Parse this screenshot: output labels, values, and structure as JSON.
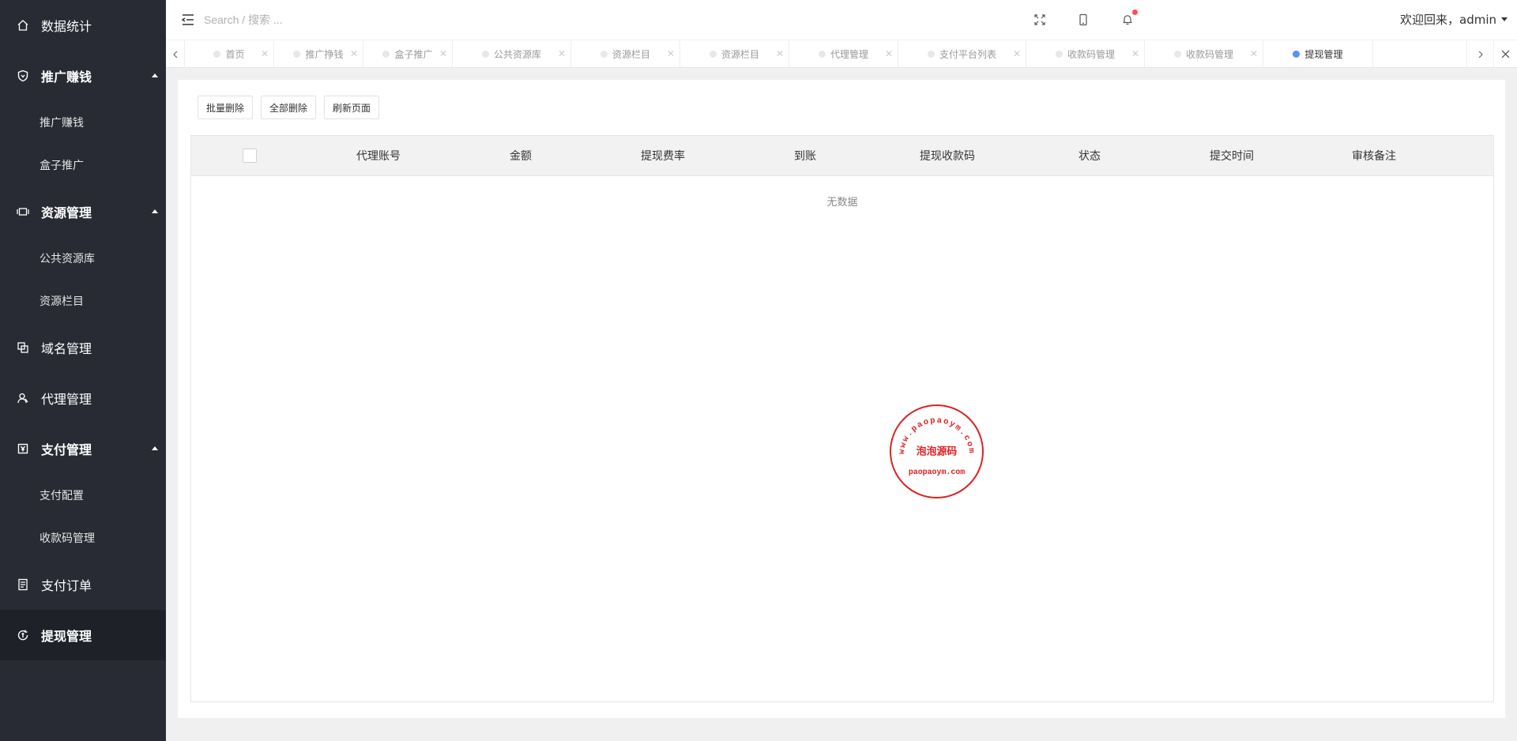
{
  "sidebar": {
    "items": [
      {
        "label": "数据统计",
        "icon": "home-icon",
        "type": "link"
      },
      {
        "label": "推广赚钱",
        "icon": "shield-icon",
        "type": "parent",
        "expanded": true,
        "children": [
          {
            "label": "推广赚钱"
          },
          {
            "label": "盒子推广"
          }
        ]
      },
      {
        "label": "资源管理",
        "icon": "resource-icon",
        "type": "parent",
        "expanded": true,
        "children": [
          {
            "label": "公共资源库"
          },
          {
            "label": "资源栏目"
          }
        ]
      },
      {
        "label": "域名管理",
        "icon": "domain-icon",
        "type": "link"
      },
      {
        "label": "代理管理",
        "icon": "agent-icon",
        "type": "link"
      },
      {
        "label": "支付管理",
        "icon": "payment-icon",
        "type": "parent",
        "expanded": true,
        "children": [
          {
            "label": "支付配置"
          },
          {
            "label": "收款码管理"
          }
        ]
      },
      {
        "label": "支付订单",
        "icon": "order-icon",
        "type": "link"
      },
      {
        "label": "提现管理",
        "icon": "withdraw-icon",
        "type": "link",
        "active": true
      }
    ]
  },
  "header": {
    "search_placeholder": "Search / 搜索 ...",
    "user_greeting": "欢迎回来，admin"
  },
  "tabs": [
    {
      "label": "首页"
    },
    {
      "label": "推广挣钱"
    },
    {
      "label": "盒子推广"
    },
    {
      "label": "公共资源库"
    },
    {
      "label": "资源栏目"
    },
    {
      "label": "资源栏目"
    },
    {
      "label": "代理管理"
    },
    {
      "label": "支付平台列表"
    },
    {
      "label": "收款码管理"
    },
    {
      "label": "收款码管理"
    },
    {
      "label": "提现管理",
      "active": true
    }
  ],
  "toolbar": {
    "batch_delete": "批量删除",
    "delete_all": "全部删除",
    "refresh_page": "刷新页面"
  },
  "table": {
    "columns": [
      "代理账号",
      "金额",
      "提现费率",
      "到账",
      "提现收款码",
      "状态",
      "提交时间",
      "审核备注"
    ],
    "rows": [],
    "empty_text": "无数据"
  },
  "watermark": {
    "top_text": "www.paopaoym.com",
    "middle_text": "泡泡源码",
    "bottom_text": "paopaoym.com",
    "color": "#e02020"
  },
  "colors": {
    "sidebar_bg": "#282b33",
    "active_tab_dot": "#5b8ff9",
    "notification": "#ff4d4f"
  }
}
